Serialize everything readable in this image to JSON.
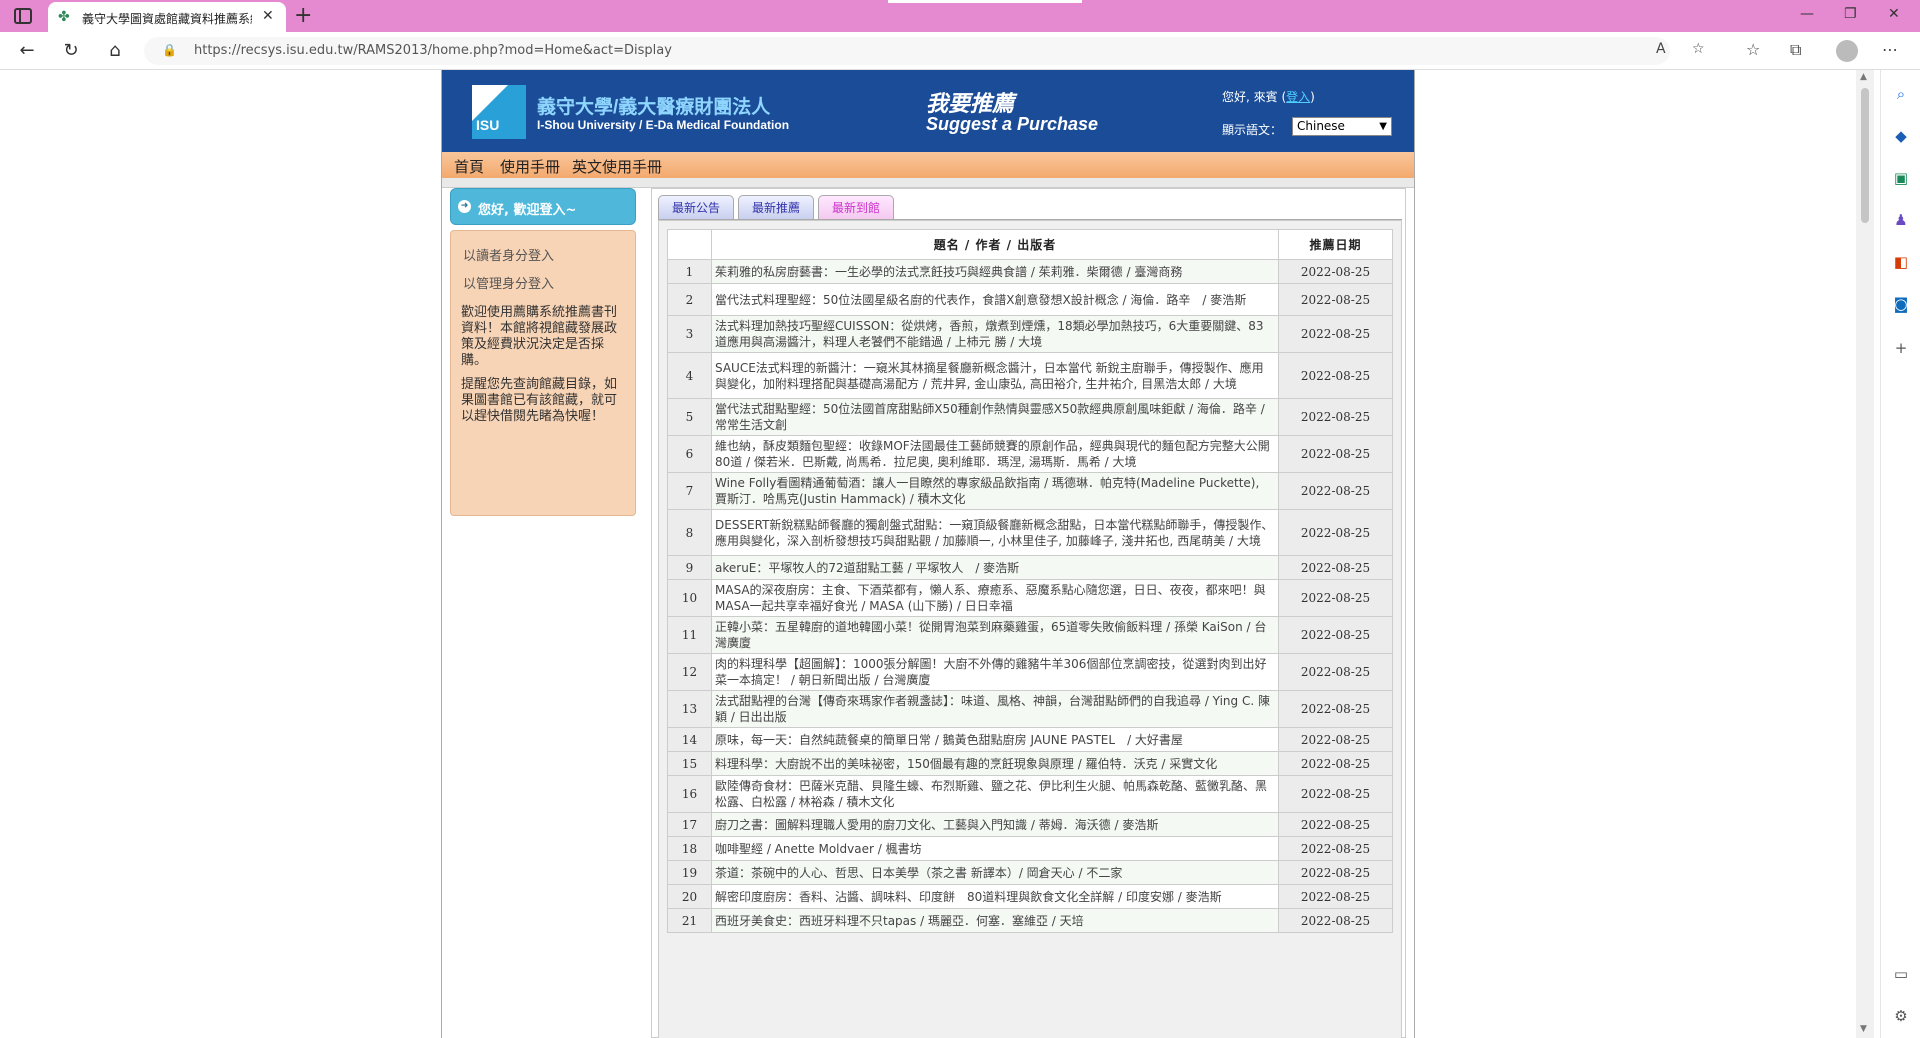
{
  "browser": {
    "tab_title": "義守大學圖資處館藏資料推薦系統",
    "url": "https://recsys.isu.edu.tw/RAMS2013/home.php?mod=Home&act=Display"
  },
  "header": {
    "org_zh": "義守大學/義大醫療財團法人",
    "org_en": "I-Shou University / E-Da Medical Foundation",
    "logo_text": "ISU",
    "suggest_zh": "我要推薦",
    "suggest_en": "Suggest a Purchase",
    "greeting": "您好, 來賓 (",
    "guest_link": "登入",
    "greeting_end": ")",
    "lang_label": "顯示語文：",
    "lang_value": "Chinese"
  },
  "menu": {
    "home": "首頁",
    "manual": "使用手冊",
    "en_manual": "英文使用手冊"
  },
  "sidebar": {
    "welcome": "您好, 歡迎登入~",
    "reader_login": "以讀者身分登入",
    "admin_login": "以管理身分登入",
    "message1": "歡迎使用薦購系統推薦書刊資料！本館將視館藏發展政策及經費狀況決定是否採購。",
    "message2": "提醒您先查詢館藏目錄，如果圖書館已有該館藏，就可以趕快借閱先睹為快喔！"
  },
  "tabs": {
    "latest_notice": "最新公告",
    "latest_recommend": "最新推薦",
    "latest_arrival": "最新到館"
  },
  "table": {
    "col_title": "題名 / 作者 / 出版者",
    "col_date": "推薦日期",
    "rows": [
      {
        "no": "1",
        "title": "茱莉雅的私房廚藝書：一生必學的法式烹飪技巧與經典食譜 / 茱莉雅．柴爾德 / 臺灣商務",
        "date": "2022-08-25"
      },
      {
        "no": "2",
        "title": "當代法式料理聖經：50位法國星級名廚的代表作，食譜X創意發想X設計概念 / 海倫．路辛　/ 麥浩斯",
        "date": "2022-08-25"
      },
      {
        "no": "3",
        "title": "法式料理加熱技巧聖經CUISSON：從烘烤，香煎，燉煮到煙燻，18類必學加熱技巧，6大重要關鍵、83道應用與高湯醬汁，料理人老饕們不能錯過 / 上柿元 勝 / 大境",
        "date": "2022-08-25"
      },
      {
        "no": "4",
        "title": "SAUCE法式料理的新醬汁：一窺米其林摘星餐廳新概念醬汁，日本當代 新銳主廚聯手，傳授製作、應用與變化，加附料理搭配與基礎高湯配方 / 荒井昇, 金山康弘, 高田裕介, 生井祐介, 目黑浩太郎 / 大境",
        "date": "2022-08-25"
      },
      {
        "no": "5",
        "title": "當代法式甜點聖經：50位法國首席甜點師X50種創作熱情與靈感X50款經典原創風味鉅獻 / 海倫．路辛 / 常常生活文創",
        "date": "2022-08-25"
      },
      {
        "no": "6",
        "title": "維也納，酥皮類麵包聖經：收錄MOF法國最佳工藝師競賽的原創作品，經典與現代的麵包配方完整大公開80道 / 傑若米．巴斯戴, 尚馬希．拉尼奧, 奧利維耶．瑪涅, 湯瑪斯．馬希 / 大境",
        "date": "2022-08-25"
      },
      {
        "no": "7",
        "title": "Wine Folly看圖精通葡萄酒：讓人一目瞭然的專家級品飲指南 / 瑪德琳．帕克特(Madeline Puckette), 賈斯汀．哈馬克(Justin Hammack) / 積木文化",
        "date": "2022-08-25"
      },
      {
        "no": "8",
        "title": "DESSERT新銳糕點師餐廳的獨創盤式甜點：一窺頂級餐廳新概念甜點，日本當代糕點師聯手，傳授製作、應用與變化，深入剖析發想技巧與甜點觀 / 加藤順一, 小林里佳子, 加藤峰子, 淺井拓也, 西尾萌美 / 大境",
        "date": "2022-08-25"
      },
      {
        "no": "9",
        "title": "akeruE：平塚牧人的72道甜點工藝 / 平塚牧人　/ 麥浩斯",
        "date": "2022-08-25"
      },
      {
        "no": "10",
        "title": "MASA的深夜廚房：主食、下酒菜都有，懶人系、療癒系、惡魔系點心隨您選，日日、夜夜，都來吧！與MASA一起共享幸福好食光 / MASA (山下勝) / 日日幸福",
        "date": "2022-08-25"
      },
      {
        "no": "11",
        "title": "正韓小菜：五星韓廚的道地韓國小菜！從開胃泡菜到麻藥雞蛋，65道零失敗偷飯料理 / 孫榮 KaiSon / 台灣廣廈",
        "date": "2022-08-25"
      },
      {
        "no": "12",
        "title": "肉的料理科學【超圖解】：1000張分解圖！大廚不外傳的雞豬牛羊306個部位烹調密技，從選對肉到出好菜一本搞定！ / 朝日新聞出版 / 台灣廣廈",
        "date": "2022-08-25"
      },
      {
        "no": "13",
        "title": "法式甜點裡的台灣【傳奇來瑪家作者親盞誌】：味道、風格、神韻，台灣甜點師們的自我追尋 / Ying C. 陳穎 / 日出出版",
        "date": "2022-08-25"
      },
      {
        "no": "14",
        "title": "原味，每一天：自然純蔬餐桌的簡單日常 / 鵝黃色甜點廚房 JAUNE PASTEL　/ 大好書屋",
        "date": "2022-08-25"
      },
      {
        "no": "15",
        "title": "料理科學：大廚說不出的美味祕密，150個最有趣的烹飪現象與原理 / 羅伯特．沃克 / 采實文化",
        "date": "2022-08-25"
      },
      {
        "no": "16",
        "title": "歐陸傳奇食材：巴薩米克醋、貝隆生蠔、布烈斯雞、鹽之花、伊比利生火腿、帕馬森乾酪、藍黴乳酪、黑松露、白松露 / 林裕森 / 積木文化",
        "date": "2022-08-25"
      },
      {
        "no": "17",
        "title": "廚刀之書：圖解料理職人愛用的廚刀文化、工藝與入門知識 / 蒂姆．海沃德 / 麥浩斯",
        "date": "2022-08-25"
      },
      {
        "no": "18",
        "title": "咖啡聖經 / Anette Moldvaer / 楓書坊",
        "date": "2022-08-25"
      },
      {
        "no": "19",
        "title": "茶道：茶碗中的人心、哲思、日本美學（茶之書 新譯本）/ 岡倉天心 / 不二家",
        "date": "2022-08-25"
      },
      {
        "no": "20",
        "title": "解密印度廚房：香料、沾醬、調味料、印度餅　80道料理與飲食文化全詳解 / 印度安娜 / 麥浩斯",
        "date": "2022-08-25"
      },
      {
        "no": "21",
        "title": "西班牙美食史：西班牙料理不只tapas / 瑪麗亞．何塞．塞維亞 / 天培",
        "date": "2022-08-25"
      }
    ]
  }
}
